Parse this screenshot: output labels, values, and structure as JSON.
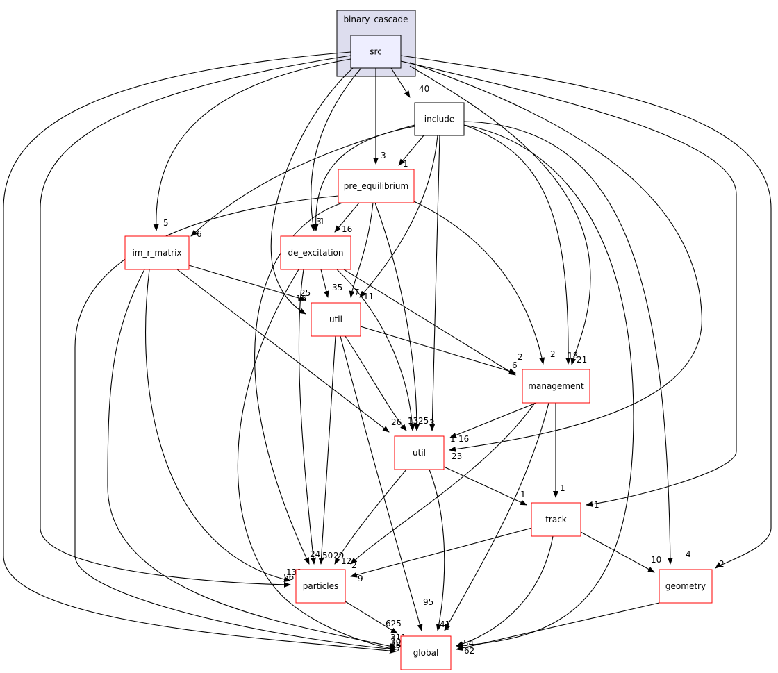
{
  "cluster": {
    "label": "binary_cascade",
    "fill": "#ddddee"
  },
  "nodes": [
    {
      "id": "src",
      "label": "src",
      "fill": "#eeeeff",
      "border": "#000000"
    },
    {
      "id": "include",
      "label": "include",
      "fill": "#ffffff",
      "border": "#000000"
    },
    {
      "id": "pre_equilibrium",
      "label": "pre_equilibrium",
      "fill": "#ffffff",
      "border": "#ff0000"
    },
    {
      "id": "im_r_matrix",
      "label": "im_r_matrix",
      "fill": "#ffffff",
      "border": "#ff0000"
    },
    {
      "id": "de_excitation",
      "label": "de_excitation",
      "fill": "#ffffff",
      "border": "#ff0000"
    },
    {
      "id": "util1",
      "label": "util",
      "fill": "#ffffff",
      "border": "#ff0000"
    },
    {
      "id": "management",
      "label": "management",
      "fill": "#ffffff",
      "border": "#ff0000"
    },
    {
      "id": "util2",
      "label": "util",
      "fill": "#ffffff",
      "border": "#ff0000"
    },
    {
      "id": "track",
      "label": "track",
      "fill": "#ffffff",
      "border": "#ff0000"
    },
    {
      "id": "particles",
      "label": "particles",
      "fill": "#ffffff",
      "border": "#ff0000"
    },
    {
      "id": "geometry",
      "label": "geometry",
      "fill": "#ffffff",
      "border": "#ff0000"
    },
    {
      "id": "global",
      "label": "global",
      "fill": "#ffffff",
      "border": "#ff0000"
    }
  ],
  "edges": [
    {
      "from": "src",
      "to": "include",
      "label": "40"
    },
    {
      "from": "src",
      "to": "pre_equilibrium",
      "label": "3"
    },
    {
      "from": "src",
      "to": "im_r_matrix",
      "label": "5"
    },
    {
      "from": "src",
      "to": "de_excitation",
      "label": "3"
    },
    {
      "from": "src",
      "to": "util1",
      "label": "25"
    },
    {
      "from": "src",
      "to": "util2",
      "label": "1"
    },
    {
      "from": "src",
      "to": "track",
      "label": "1"
    },
    {
      "from": "src",
      "to": "geometry",
      "label": "2"
    },
    {
      "from": "src",
      "to": "particles",
      "label": "132"
    },
    {
      "from": "src",
      "to": "global",
      "label": "311"
    },
    {
      "from": "src",
      "to": "management",
      "label": "21"
    },
    {
      "from": "include",
      "to": "pre_equilibrium",
      "label": "1"
    },
    {
      "from": "include",
      "to": "im_r_matrix",
      "label": "6"
    },
    {
      "from": "include",
      "to": "de_excitation",
      "label": "1"
    },
    {
      "from": "include",
      "to": "util1",
      "label": "11"
    },
    {
      "from": "include",
      "to": "util2",
      "label": "3"
    },
    {
      "from": "include",
      "to": "management",
      "label": "18"
    },
    {
      "from": "include",
      "to": "geometry",
      "label": "4"
    },
    {
      "from": "include",
      "to": "global",
      "label": "4"
    },
    {
      "from": "pre_equilibrium",
      "to": "de_excitation",
      "label": "16"
    },
    {
      "from": "pre_equilibrium",
      "to": "util1",
      "label": "7"
    },
    {
      "from": "pre_equilibrium",
      "to": "util2",
      "label": "25"
    },
    {
      "from": "pre_equilibrium",
      "to": "management",
      "label": "2"
    },
    {
      "from": "pre_equilibrium",
      "to": "particles",
      "label": "24"
    },
    {
      "from": "pre_equilibrium",
      "to": "global",
      "label": "30"
    },
    {
      "from": "im_r_matrix",
      "to": "util1",
      "label": "16"
    },
    {
      "from": "im_r_matrix",
      "to": "util2",
      "label": "26"
    },
    {
      "from": "im_r_matrix",
      "to": "particles",
      "label": "56"
    },
    {
      "from": "im_r_matrix",
      "to": "global",
      "label": "17"
    },
    {
      "from": "de_excitation",
      "to": "util1",
      "label": "35"
    },
    {
      "from": "de_excitation",
      "to": "util2",
      "label": "13"
    },
    {
      "from": "de_excitation",
      "to": "management",
      "label": "6"
    },
    {
      "from": "de_excitation",
      "to": "particles",
      "label": "50"
    },
    {
      "from": "de_excitation",
      "to": "global",
      "label": "46"
    },
    {
      "from": "util1",
      "to": "management",
      "label": "2"
    },
    {
      "from": "util1",
      "to": "util2",
      "label": "13"
    },
    {
      "from": "util1",
      "to": "particles",
      "label": "29"
    },
    {
      "from": "util1",
      "to": "global",
      "label": "95"
    },
    {
      "from": "util2",
      "to": "track",
      "label": "1"
    },
    {
      "from": "util2",
      "to": "particles",
      "label": "12"
    },
    {
      "from": "util2",
      "to": "global",
      "label": "41"
    },
    {
      "from": "management",
      "to": "util2",
      "label": "16"
    },
    {
      "from": "management",
      "to": "particles",
      "label": "2"
    },
    {
      "from": "management",
      "to": "track",
      "label": "1"
    },
    {
      "from": "management",
      "to": "global",
      "label": "8"
    },
    {
      "from": "track",
      "to": "particles",
      "label": "9"
    },
    {
      "from": "track",
      "to": "geometry",
      "label": "10"
    },
    {
      "from": "track",
      "to": "global",
      "label": "54"
    },
    {
      "from": "particles",
      "to": "global",
      "label": "625"
    },
    {
      "from": "geometry",
      "to": "global",
      "label": "62"
    }
  ],
  "extra_labels": [
    "23"
  ]
}
